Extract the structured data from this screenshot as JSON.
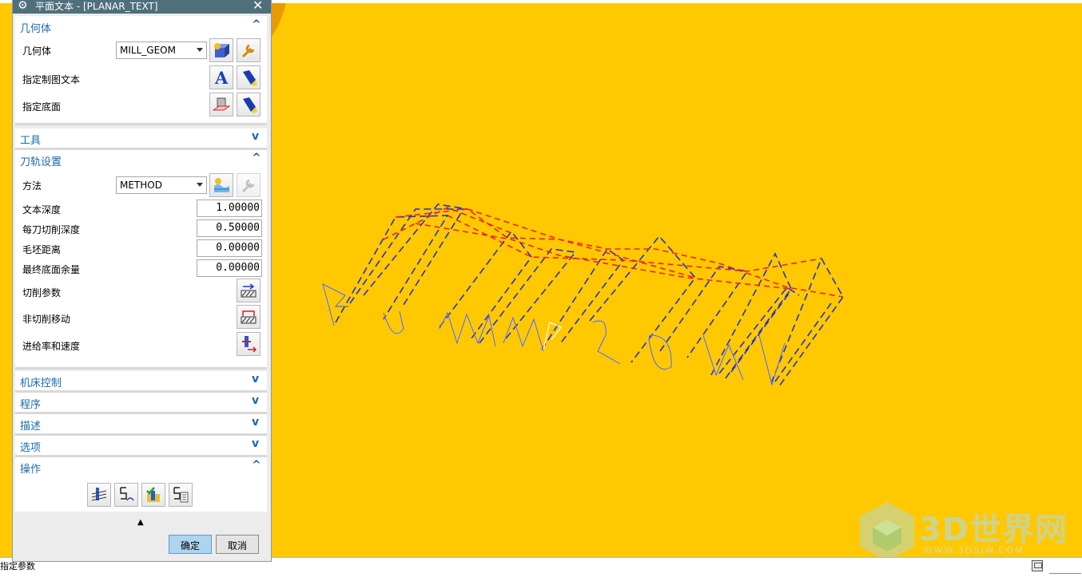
{
  "dialog": {
    "title": "平面文本 - [PLANAR_TEXT]",
    "close_symbol": "✕",
    "sections": {
      "geometry": {
        "title": "几何体",
        "expanded": true,
        "geometry_label": "几何体",
        "geometry_value": "MILL_GEOM",
        "drafting_text_label": "指定制图文本",
        "floor_label": "指定底面"
      },
      "tool": {
        "title": "工具",
        "expanded": false
      },
      "path_settings": {
        "title": "刀轨设置",
        "expanded": true,
        "method_label": "方法",
        "method_value": "METHOD",
        "text_depth_label": "文本深度",
        "text_depth_value": "1.00000",
        "depth_per_cut_label": "每刀切削深度",
        "depth_per_cut_value": "0.50000",
        "blank_distance_label": "毛坯距离",
        "blank_distance_value": "0.00000",
        "final_floor_stock_label": "最终底面余量",
        "final_floor_stock_value": "0.00000",
        "cutting_params_label": "切削参数",
        "non_cutting_moves_label": "非切削移动",
        "feeds_speeds_label": "进给率和速度"
      },
      "machine_control": {
        "title": "机床控制",
        "expanded": false
      },
      "program": {
        "title": "程序",
        "expanded": false
      },
      "description": {
        "title": "描述",
        "expanded": false
      },
      "options": {
        "title": "选项",
        "expanded": false
      },
      "actions": {
        "title": "操作",
        "expanded": true
      }
    },
    "ok_label": "确定",
    "cancel_label": "取消"
  },
  "status_bar": {
    "text": "指定参数"
  },
  "watermark": {
    "text": "3D世界网",
    "url": "WWW.3DSJW.COM"
  },
  "colors": {
    "viewport_bg": "#FFC800",
    "titlebar": "#4f6f7b",
    "section_title": "#1c6aa8",
    "toolpath_cut": "#2233cc",
    "toolpath_rapid": "#ee2222"
  },
  "icons": [
    "gear-icon",
    "close-icon",
    "new-geometry-icon",
    "edit-wrench-icon",
    "text-a-icon",
    "flashlight-icon",
    "floor-icon",
    "method-new-icon",
    "cutting-params-icon",
    "non-cutting-moves-icon",
    "feeds-speeds-icon",
    "generate-icon",
    "replay-icon",
    "verify-icon",
    "list-icon"
  ]
}
